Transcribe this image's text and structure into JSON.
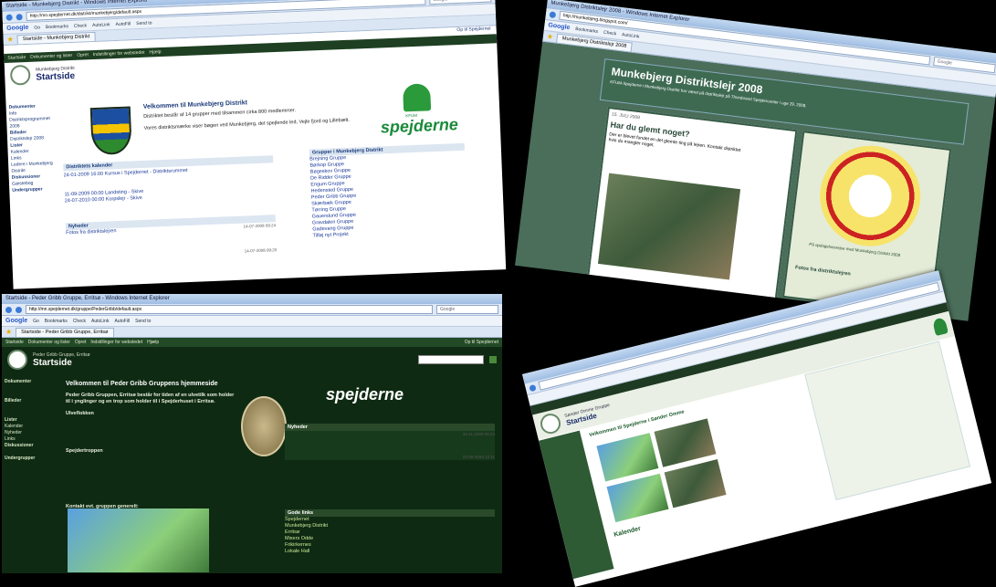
{
  "s1": {
    "title_bar": "Startside - Munkebjerg Distrikt - Windows Internet Explorer",
    "url": "http://mn.spejdernet.dk/distrikt/munkebjerg/default.aspx",
    "search": "Google",
    "google_label": "Google",
    "toolbar_items": [
      "Go",
      "Bookmarks",
      "Check",
      "AutoLink",
      "AutoFill",
      "Send to"
    ],
    "tab": "Startside - Munkebjerg Distrikt",
    "top_link": "Op til Spejdernet",
    "nav": [
      "Startside",
      "Dokumenter og lister",
      "Opret",
      "Indstillinger for webstedet",
      "Hjælp"
    ],
    "site": "Munkebjerg Distrikt",
    "page_title": "Startside",
    "sidebar": [
      "Dokumenter",
      "Info",
      "Distriktsprogrammet 2008",
      "Billeder",
      "Distriktslejr 2008",
      "Lister",
      "Kalender",
      "Links",
      "Ledere i Munkebjerg Distrikt",
      "Diskussioner",
      "Gæstebog",
      "Undergrupper"
    ],
    "welcome_h": "Velkommen til Munkebjerg Distrikt",
    "welcome_1": "Distriktet består af 14 grupper med tilsammen cirka 800 medlemmer.",
    "welcome_2": "Vores distriktsmærke viser bøgen ved Munkebjerg, det spejlende led, Vejle fjord og Lillebælt.",
    "cal_h": "Distriktets kalender",
    "cal": [
      "24-01-2009 16:00  Kursus i Spejdernet - Distriktsrummet",
      "11-09-2009 00:00  Landsting - Skive",
      "24-07-2010 00:00  Korpslejr - Skive"
    ],
    "news_h": "Nyheder",
    "news_date1": "14-07-2008 09:24",
    "news_date2": "14-07-2008 09:20",
    "news_1": "Fotos fra distriktslejren",
    "groups_h": "Grupper i Munkebjerg Distrikt",
    "groups": [
      "Brejning Gruppe",
      "Børkop Gruppe",
      "Bøgeskov Gruppe",
      "De Ridder Gruppe",
      "Engum Gruppe",
      "Hedensted Gruppe",
      "Peder Gribb Gruppe",
      "Skærbæk Gruppe",
      "Tørring Gruppe",
      "Gauerslund Gruppe",
      "Gravdalen Gruppe",
      "Gadevang Gruppe",
      "Tilføj nyt Projekt"
    ],
    "logo_text": "spejderne",
    "kfum": "KFUM"
  },
  "s2": {
    "title_bar": "Munkebjerg Distriktslejr 2008 - Windows Internet Explorer",
    "url": "http://munkebjerg.blogspot.com/",
    "tab": "Munkebjerg Distriktslejr 2008",
    "blog_title": "Munkebjerg Distriktslejr 2008",
    "blog_sub": "KFUM-Spejderne i Munkebjerg Distrikt har været på distriktslejr på Thorsbrand Spejdercenter i uge 29, 2008.",
    "post_date": "15. JULI 2008",
    "post_title": "Har du glemt noget?",
    "post_text": "Der er blevet fundet en del glemte ting på lejren. Kontakt distriktet hvis du mangler noget.",
    "side_label": "Fotos fra distriktslejren",
    "patch_text": "På opdagelsesrejse med Munkebjerg Distrikt 2008"
  },
  "s3": {
    "title_bar": "Startside - Peder Gribb Gruppe, Erritsø - Windows Internet Explorer",
    "url": "http://mn.spejdernet.dk/gruppe/PederGribb/default.aspx",
    "tab": "Startside - Peder Gribb Gruppe, Erritsø",
    "top_link": "Op til Spejdernet",
    "site": "Peder Gribb Gruppe, Erritsø",
    "page_title": "Startside",
    "welcome_h": "Velkommen til Peder Gribb Gruppens hjemmeside",
    "welcome_b": "Peder Gribb Gruppen, Erritsø består for tiden af en ulvetilk som holder til i ynglinger og en trop som holder til i Spejderhuset i Erritsø.",
    "ulve_h": "Ulveflokken",
    "spejder_h": "Spejdertroppen",
    "kontakt_h": "Kontakt evt. gruppen generelt:",
    "sidebar": [
      "Dokumenter",
      "Billeder",
      "Lister",
      "Kalender",
      "Nyheder",
      "Links",
      "Diskussioner",
      "Undergrupper"
    ],
    "nyheder_h": "Nyheder",
    "news_date1": "16-11-2008 09:24",
    "news_date2": "23-09-2008 12:11",
    "gode_links_h": "Gode links",
    "gode_links": [
      "Spejdernet",
      "Munkebjerg Distrikt",
      "Erritsø",
      "Mixers Odde",
      "Frikirkernes",
      "Lokale Hall"
    ],
    "logo_text": "spejderne"
  },
  "s4": {
    "site": "Sønder Omme Gruppe",
    "page_title": "Startside",
    "welcome_h": "Velkommen til Spejderne i Sønder Omme",
    "kalender_h": "Kalender"
  }
}
